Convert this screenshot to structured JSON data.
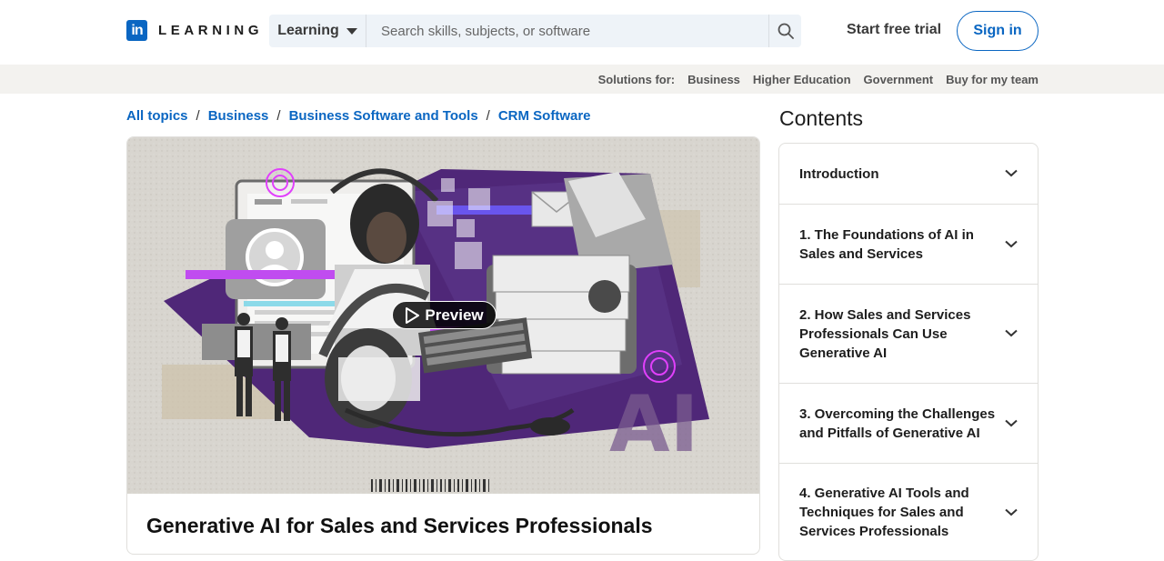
{
  "header": {
    "logo_mark": "in",
    "logo_text": "LEARNING",
    "search_type": "Learning",
    "search_placeholder": "Search skills, subjects, or software",
    "start_trial": "Start free trial",
    "sign_in": "Sign in"
  },
  "solutions": {
    "label": "Solutions for:",
    "links": [
      "Business",
      "Higher Education",
      "Government",
      "Buy for my team"
    ]
  },
  "breadcrumb": [
    "All topics",
    "Business",
    "Business Software and Tools",
    "CRM Software"
  ],
  "course": {
    "preview_label": "Preview",
    "title": "Generative AI for Sales and Services Professionals",
    "image_text": "AI"
  },
  "contents": {
    "title": "Contents",
    "items": [
      "Introduction",
      "1. The Foundations of AI in Sales and Services",
      "2. How Sales and Services Professionals Can Use Generative AI",
      "3. Overcoming the Challenges and Pitfalls of Generative AI",
      "4. Generative AI Tools and Techniques for Sales and Services Professionals"
    ]
  },
  "colors": {
    "brand": "#0a66c2",
    "accent_purple": "#5b2a86",
    "neon": "#d94cf2"
  },
  "icons": [
    "linkedin-logo-icon",
    "caret-down-icon",
    "search-icon",
    "play-icon",
    "chevron-down-icon"
  ]
}
